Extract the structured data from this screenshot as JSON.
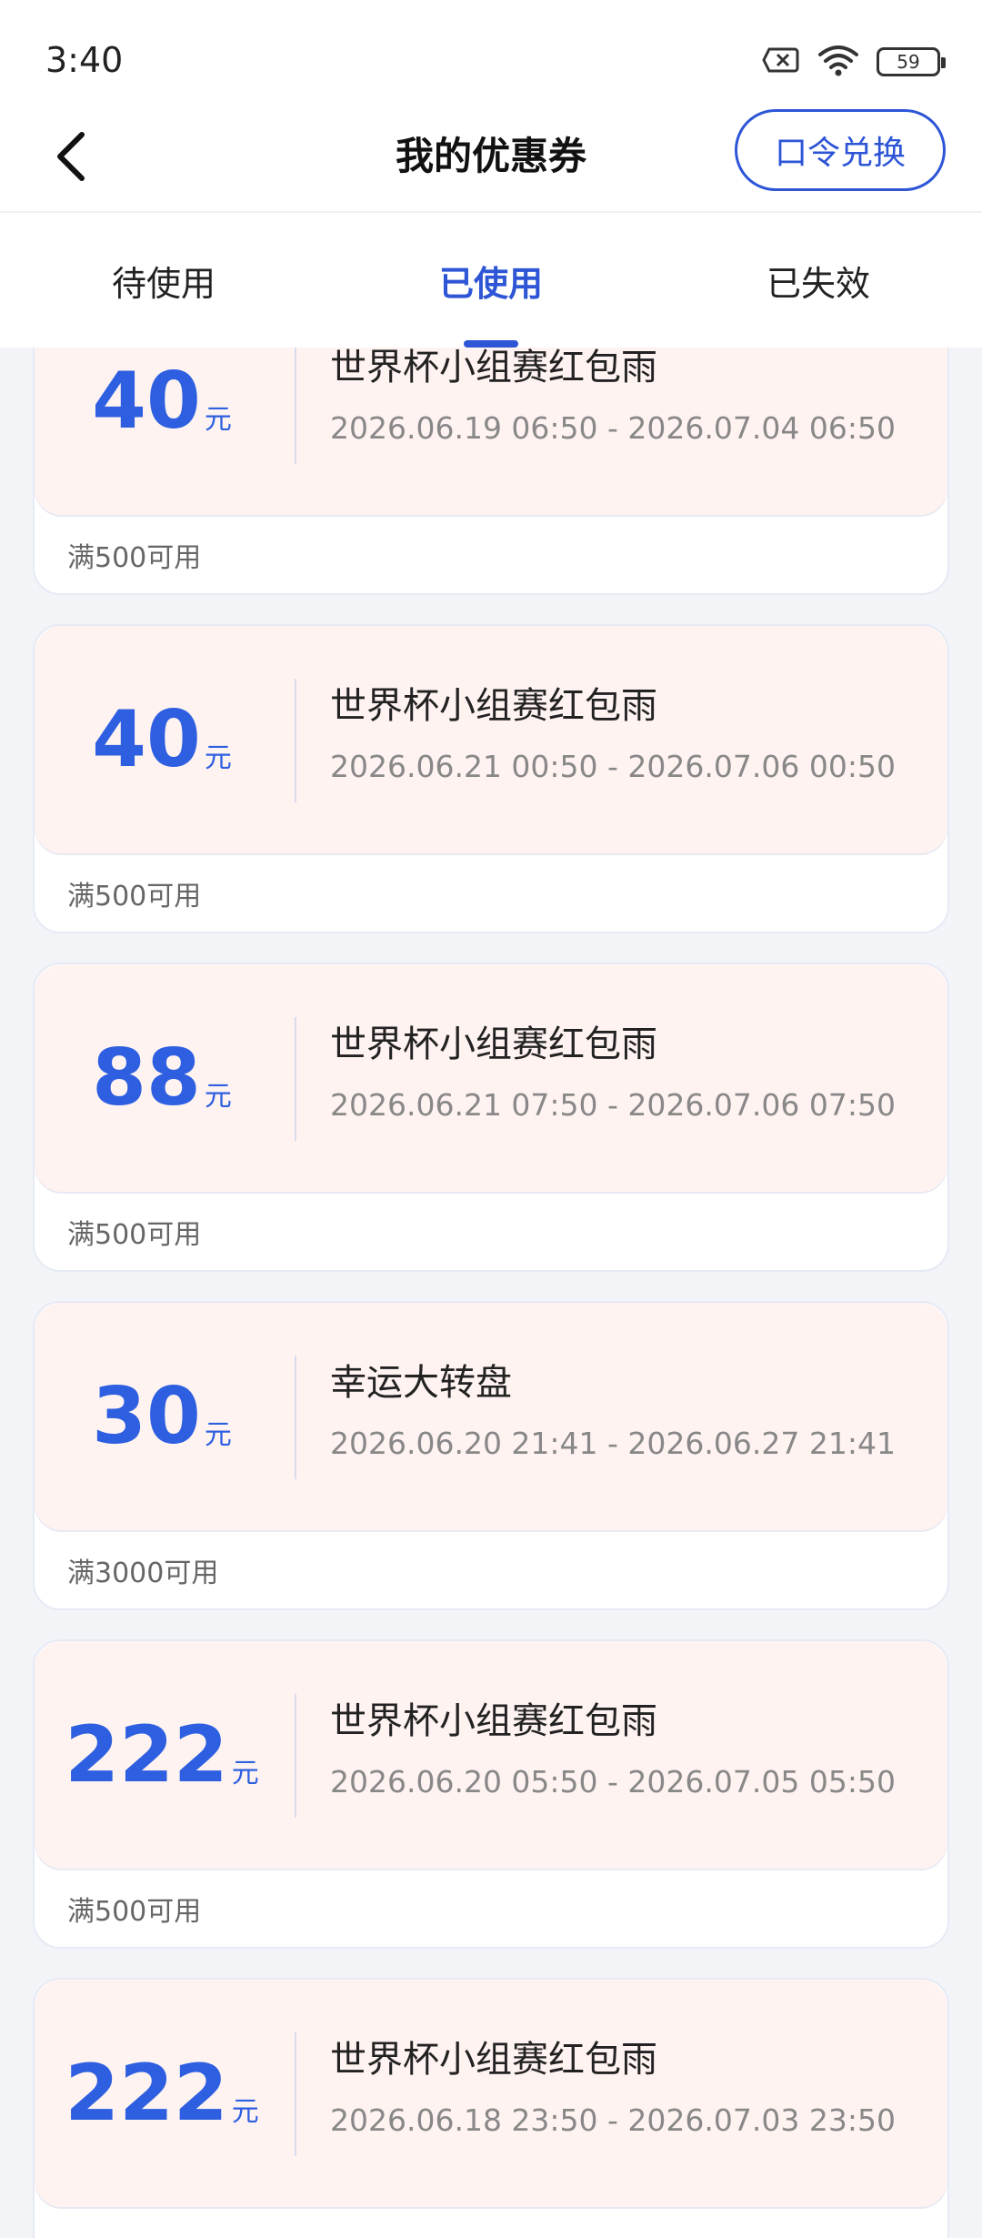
{
  "status_bar": {
    "time": "3:40",
    "battery": "59"
  },
  "header": {
    "title": "我的优惠券",
    "redeem_label": "口令兑换"
  },
  "tabs": [
    {
      "label": "待使用",
      "active": false
    },
    {
      "label": "已使用",
      "active": true
    },
    {
      "label": "已失效",
      "active": false
    }
  ],
  "coupons": [
    {
      "amount": "40",
      "unit": "元",
      "name": "世界杯小组赛红包雨",
      "range": "2026.06.19 06:50 - 2026.07.04 06:50",
      "condition": "满500可用"
    },
    {
      "amount": "40",
      "unit": "元",
      "name": "世界杯小组赛红包雨",
      "range": "2026.06.21 00:50 - 2026.07.06 00:50",
      "condition": "满500可用"
    },
    {
      "amount": "88",
      "unit": "元",
      "name": "世界杯小组赛红包雨",
      "range": "2026.06.21 07:50 - 2026.07.06 07:50",
      "condition": "满500可用"
    },
    {
      "amount": "30",
      "unit": "元",
      "name": "幸运大转盘",
      "range": "2026.06.20 21:41 - 2026.06.27 21:41",
      "condition": "满3000可用"
    },
    {
      "amount": "222",
      "unit": "元",
      "name": "世界杯小组赛红包雨",
      "range": "2026.06.20 05:50 - 2026.07.05 05:50",
      "condition": "满500可用"
    },
    {
      "amount": "222",
      "unit": "元",
      "name": "世界杯小组赛红包雨",
      "range": "2026.06.18 23:50 - 2026.07.03 23:50",
      "condition": ""
    }
  ],
  "colors": {
    "accent": "#2d55d6",
    "coupon_bg": "#fff3f1",
    "amount": "#2d5fe0"
  },
  "icons": {
    "back": "chevron-left-icon",
    "sim": "sim-blocked-icon",
    "wifi": "wifi-icon",
    "battery": "battery-icon"
  }
}
